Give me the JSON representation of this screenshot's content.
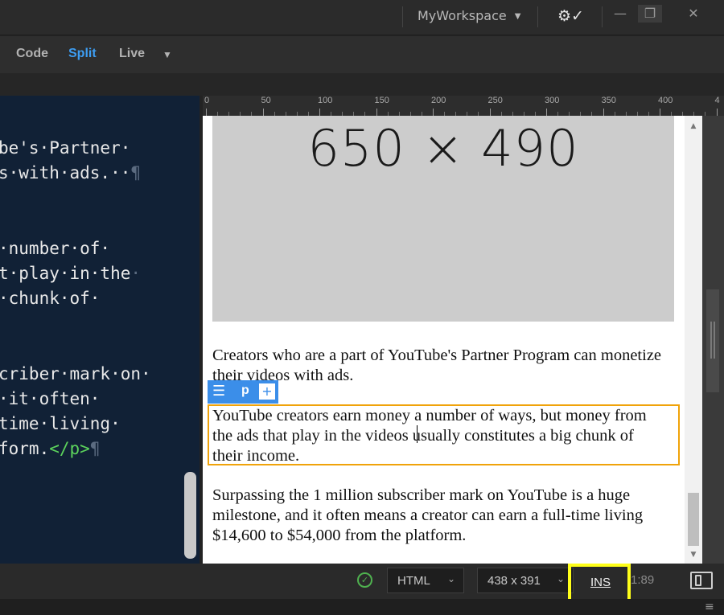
{
  "titlebar": {
    "workspace": "MyWorkspace",
    "sync_icon": "gear-sync-icon",
    "minimize_icon": "minimize-icon",
    "restore_icon": "restore-icon",
    "close_icon": "close-icon"
  },
  "viewbar": {
    "code_label": "Code",
    "split_label": "Split",
    "live_label": "Live",
    "active": "Split",
    "accent": "#3d9df2"
  },
  "code_lines": {
    "l1": "be's·Partner·",
    "l2": "s·with·ads.··",
    "l3": "·number·of·",
    "l4": "t·play·in·the",
    "l5": "·chunk·of·",
    "l6": "criber·mark·on·",
    "l7": "·it·often·",
    "l8": "time·living·",
    "l9a": "form.",
    "l9tag": "</p>"
  },
  "ruler": {
    "labels": [
      "0",
      "50",
      "100",
      "150",
      "200",
      "250",
      "300",
      "350",
      "400",
      "4"
    ]
  },
  "live": {
    "placeholder_text": "650 × 490",
    "p1": "Creators who are a part of YouTube's Partner Program can monetize their videos with ads.",
    "p2": "YouTube creators earn money a number of ways, but money from the ads that play in the videos usually constitutes a big chunk of their income.",
    "p3": "Surpassing the 1 million subscriber mark on YouTube is a huge milestone, and it often means a creator can earn a full-time living $14,600 to $54,000 from the platform.",
    "hud_tag": "p",
    "hud_plus": "+",
    "selection_color": "#f0a30a"
  },
  "status": {
    "doc_type": "HTML",
    "viewport_size": "438 x 391",
    "mode": "INS",
    "cursor_pos": "1:89",
    "highlight_color": "#ffff1a"
  }
}
